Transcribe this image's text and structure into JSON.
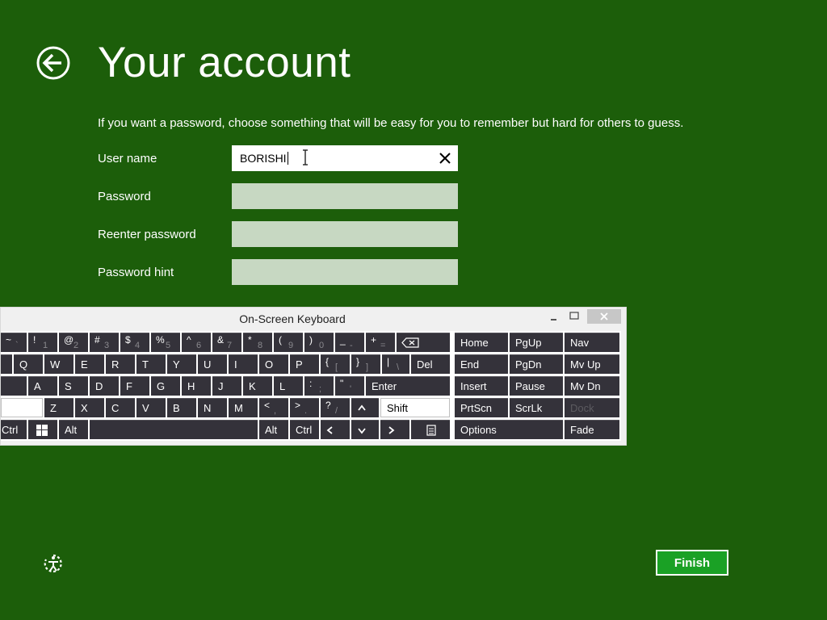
{
  "page": {
    "title": "Your account",
    "intro": "If you want a password, choose something that will be easy for you to remember but hard for others to guess.",
    "back_icon": "back-arrow-icon",
    "accent": "#1c5e0a"
  },
  "form": {
    "user_name": {
      "label": "User name",
      "value": "BORISHI"
    },
    "password": {
      "label": "Password",
      "value": ""
    },
    "reenter_password": {
      "label": "Reenter password",
      "value": ""
    },
    "password_hint": {
      "label": "Password hint",
      "value": ""
    }
  },
  "osk": {
    "title": "On-Screen Keyboard",
    "row1": [
      {
        "shift": "~",
        "base": "`"
      },
      {
        "shift": "!",
        "base": "1"
      },
      {
        "shift": "@",
        "base": "2"
      },
      {
        "shift": "#",
        "base": "3"
      },
      {
        "shift": "$",
        "base": "4"
      },
      {
        "shift": "%",
        "base": "5"
      },
      {
        "shift": "^",
        "base": "6"
      },
      {
        "shift": "&",
        "base": "7"
      },
      {
        "shift": "*",
        "base": "8"
      },
      {
        "shift": "(",
        "base": "9"
      },
      {
        "shift": ")",
        "base": "0"
      },
      {
        "shift": "_",
        "base": "-"
      },
      {
        "shift": "+",
        "base": "="
      }
    ],
    "row2": [
      "Q",
      "W",
      "E",
      "R",
      "T",
      "Y",
      "U",
      "I",
      "O",
      "P"
    ],
    "row2_punct": [
      {
        "shift": "{",
        "base": "["
      },
      {
        "shift": "}",
        "base": "]"
      },
      {
        "shift": "|",
        "base": "\\"
      }
    ],
    "row3": [
      "A",
      "S",
      "D",
      "F",
      "G",
      "H",
      "J",
      "K",
      "L"
    ],
    "row3_punct": [
      {
        "shift": ":",
        "base": ";"
      },
      {
        "shift": "\"",
        "base": "'"
      }
    ],
    "row4": [
      "Z",
      "X",
      "C",
      "V",
      "B",
      "N",
      "M"
    ],
    "row4_punct": [
      {
        "shift": "<",
        "base": ","
      },
      {
        "shift": ">",
        "base": "."
      },
      {
        "shift": "?",
        "base": "/"
      }
    ],
    "del": "Del",
    "enter": "Enter",
    "shift": "Shift",
    "ctrl": "Ctrl",
    "alt": "Alt",
    "alt_right": "Alt",
    "ctrl_right": "Ctrl",
    "nav_keys": {
      "home": "Home",
      "pgup": "PgUp",
      "nav": "Nav",
      "end": "End",
      "pgdn": "PgDn",
      "mvup": "Mv Up",
      "insert": "Insert",
      "pause": "Pause",
      "mvdn": "Mv Dn",
      "prtscn": "PrtScn",
      "scrlk": "ScrLk",
      "dock": "Dock",
      "options": "Options",
      "fade": "Fade"
    }
  },
  "footer": {
    "finish": "Finish",
    "ease_icon": "ease-of-access-icon"
  }
}
